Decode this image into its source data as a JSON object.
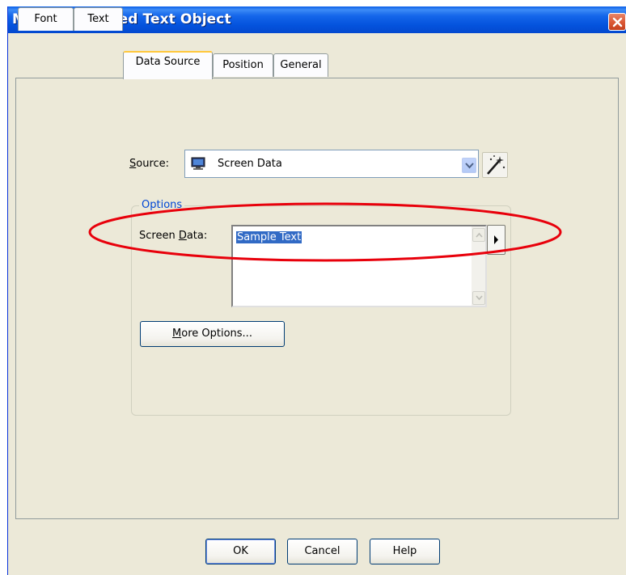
{
  "window": {
    "title": "Modify Selected Text Object",
    "close_icon": "close-icon"
  },
  "tabs": [
    {
      "label": "Font",
      "active": false
    },
    {
      "label": "Text",
      "active": false
    },
    {
      "label": "Data Source",
      "active": true
    },
    {
      "label": "Position",
      "active": false
    },
    {
      "label": "General",
      "active": false
    }
  ],
  "source": {
    "label": "Source:",
    "mnemonic": "S",
    "label_rest": "ource:",
    "value": "Screen Data",
    "icon": "monitor-icon"
  },
  "wizard": {
    "icon": "magic-wand-icon"
  },
  "options": {
    "legend": "Options",
    "screen_data_label": "Screen Data:",
    "screen_data_pre": "Screen ",
    "screen_data_mnemonic": "D",
    "screen_data_post": "ata:",
    "text_value": "Sample Text"
  },
  "more_options": {
    "label": "More Options...",
    "mnemonic": "M",
    "label_rest": "ore Options..."
  },
  "footer": {
    "ok": "OK",
    "cancel": "Cancel",
    "help": "Help"
  },
  "colors": {
    "highlight_ellipse": "#e8000b",
    "title_bar": "#0453dd",
    "selection": "#316ac5"
  }
}
